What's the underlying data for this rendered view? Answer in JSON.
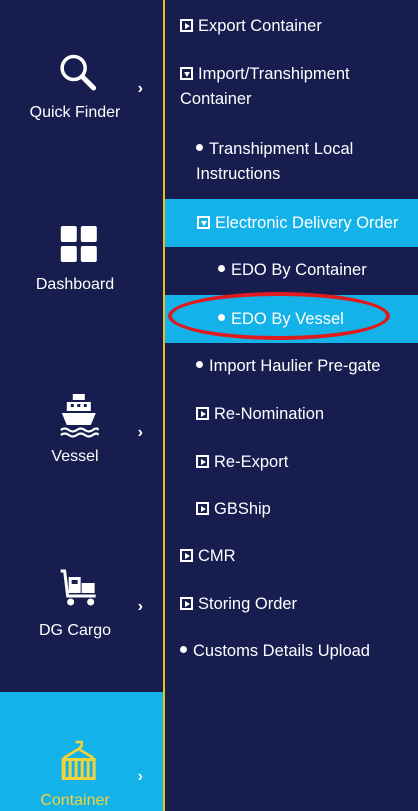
{
  "sidebar": {
    "items": [
      {
        "label": "Quick Finder",
        "icon": "search-icon",
        "has_chevron": true
      },
      {
        "label": "Dashboard",
        "icon": "dashboard-grid-icon",
        "has_chevron": false
      },
      {
        "label": "Vessel",
        "icon": "ship-icon",
        "has_chevron": true
      },
      {
        "label": "DG Cargo",
        "icon": "dg-cargo-icon",
        "has_chevron": true
      },
      {
        "label": "Container",
        "icon": "container-crane-icon",
        "has_chevron": true,
        "active": true
      }
    ],
    "chevron": "›"
  },
  "submenu": {
    "items": [
      {
        "label": "Export Container",
        "marker": "expand-box"
      },
      {
        "label": "Import/Transhipment Container",
        "marker": "collapse-box"
      },
      {
        "label": "Transhipment Local Instructions",
        "marker": "bullet"
      },
      {
        "label": "Electronic Delivery Order",
        "marker": "collapse-box",
        "highlighted": true
      },
      {
        "label": "EDO By Container",
        "marker": "bullet"
      },
      {
        "label": "EDO By Vessel",
        "marker": "bullet",
        "highlighted": true,
        "annotated": true
      },
      {
        "label": "Import Haulier Pre-gate",
        "marker": "bullet"
      },
      {
        "label": "Re-Nomination",
        "marker": "expand-box"
      },
      {
        "label": "Re-Export",
        "marker": "expand-box"
      },
      {
        "label": "GBShip",
        "marker": "expand-box"
      },
      {
        "label": "CMR",
        "marker": "expand-box"
      },
      {
        "label": "Storing Order",
        "marker": "expand-box"
      },
      {
        "label": "Customs Details Upload",
        "marker": "bullet"
      }
    ]
  },
  "colors": {
    "background": "#171d4e",
    "highlight": "#13b2e8",
    "divider": "#e8c21a",
    "active_text": "#f4d23a",
    "annotation": "#e01a1f"
  }
}
